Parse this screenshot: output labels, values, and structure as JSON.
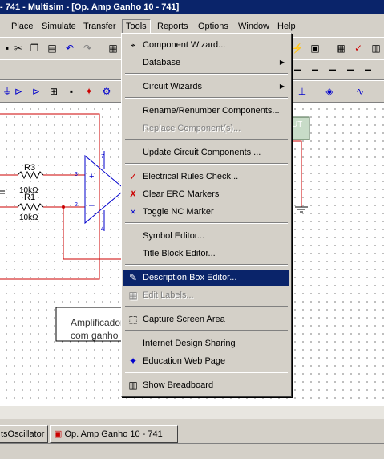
{
  "window": {
    "title": "- 741 - Multisim - [Op. Amp Ganho 10 - 741]"
  },
  "menubar": {
    "items": [
      "Place",
      "Simulate",
      "Transfer",
      "Tools",
      "Reports",
      "Options",
      "Window",
      "Help"
    ],
    "active": "Tools"
  },
  "tools_menu": {
    "items": [
      {
        "label": "Component Wizard...",
        "icon": "wizard-icon",
        "enabled": true
      },
      {
        "label": "Database",
        "submenu": true,
        "enabled": true
      },
      {
        "label": "Circuit Wizards",
        "submenu": true,
        "enabled": true
      },
      {
        "label": "Rename/Renumber Components...",
        "enabled": true
      },
      {
        "label": "Replace Component(s)...",
        "enabled": false
      },
      {
        "label": "Update Circuit Components ...",
        "enabled": true
      },
      {
        "label": "Electrical Rules Check...",
        "icon": "erc-check-icon",
        "enabled": true
      },
      {
        "label": "Clear ERC Markers",
        "icon": "erc-clear-icon",
        "enabled": true
      },
      {
        "label": "Toggle NC Marker",
        "icon": "nc-marker-icon",
        "enabled": true
      },
      {
        "label": "Symbol Editor...",
        "enabled": true
      },
      {
        "label": "Title Block Editor...",
        "enabled": true
      },
      {
        "label": "Description Box Editor...",
        "icon": "description-box-icon",
        "enabled": true,
        "selected": true
      },
      {
        "label": "Edit Labels...",
        "icon": "edit-labels-icon",
        "enabled": false
      },
      {
        "label": "Capture Screen Area",
        "icon": "capture-icon",
        "enabled": true
      },
      {
        "label": "Internet Design Sharing",
        "enabled": true
      },
      {
        "label": "Education Web Page",
        "icon": "education-icon",
        "enabled": true
      },
      {
        "label": "Show Breadboard",
        "icon": "breadboard-icon",
        "enabled": true
      }
    ]
  },
  "schematic": {
    "r3_label": "R3",
    "r3_value": "10kΩ",
    "r1_label": "R1",
    "r1_value": "10kΩ",
    "pin7": "7",
    "pin3": "3",
    "pin2": "2",
    "pin4": "4",
    "pin_plus": "+",
    "pin_minus": "–",
    "out_label": "UT",
    "textbox_line1": "Amplificador",
    "textbox_line2": "com ganho"
  },
  "tabs": [
    "tsOscillator",
    "Op. Amp Ganho 10 - 741"
  ],
  "colors": {
    "wire_red": "#cc0000",
    "selection": "#0a246a",
    "component_blue": "#0000cc"
  }
}
